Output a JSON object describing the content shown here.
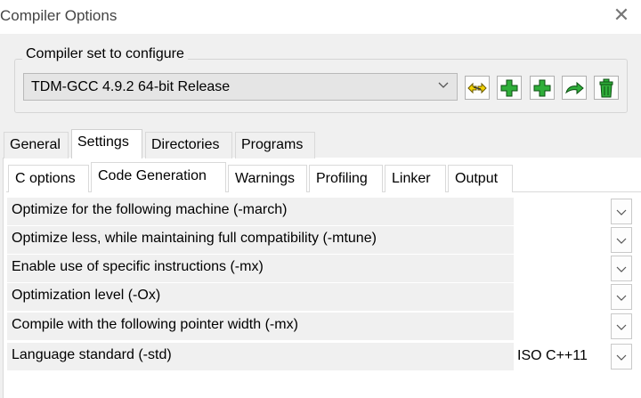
{
  "window": {
    "title": "Compiler Options",
    "close_glyph": "✕"
  },
  "compiler_set": {
    "group_label": "Compiler set to configure",
    "selected": "TDM-GCC 4.9.2 64-bit Release"
  },
  "toolbar": {
    "icons": [
      "find-compilers-icon",
      "add-compiler-icon",
      "add-blank-compiler-icon",
      "rename-compiler-icon",
      "delete-compiler-icon"
    ]
  },
  "main_tabs": [
    {
      "label": "General"
    },
    {
      "label": "Settings",
      "active": true
    },
    {
      "label": "Directories"
    },
    {
      "label": "Programs"
    }
  ],
  "sub_tabs": [
    {
      "label": "C options"
    },
    {
      "label": "Code Generation",
      "active": true
    },
    {
      "label": "Warnings"
    },
    {
      "label": "Profiling"
    },
    {
      "label": "Linker"
    },
    {
      "label": "Output"
    }
  ],
  "options": [
    {
      "label": "Optimize for the following machine (-march)",
      "value": ""
    },
    {
      "label": "Optimize less, while maintaining full compatibility (-mtune)",
      "value": ""
    },
    {
      "label": "Enable use of specific instructions (-mx)",
      "value": ""
    },
    {
      "label": "Optimization level (-Ox)",
      "value": ""
    },
    {
      "label": "Compile with the following pointer width (-mx)",
      "value": ""
    },
    {
      "label": "Language standard (-std)",
      "value": "ISO C++11"
    }
  ],
  "colors": {
    "icon_green": "#2fae3a",
    "icon_yellow": "#f3d300"
  }
}
